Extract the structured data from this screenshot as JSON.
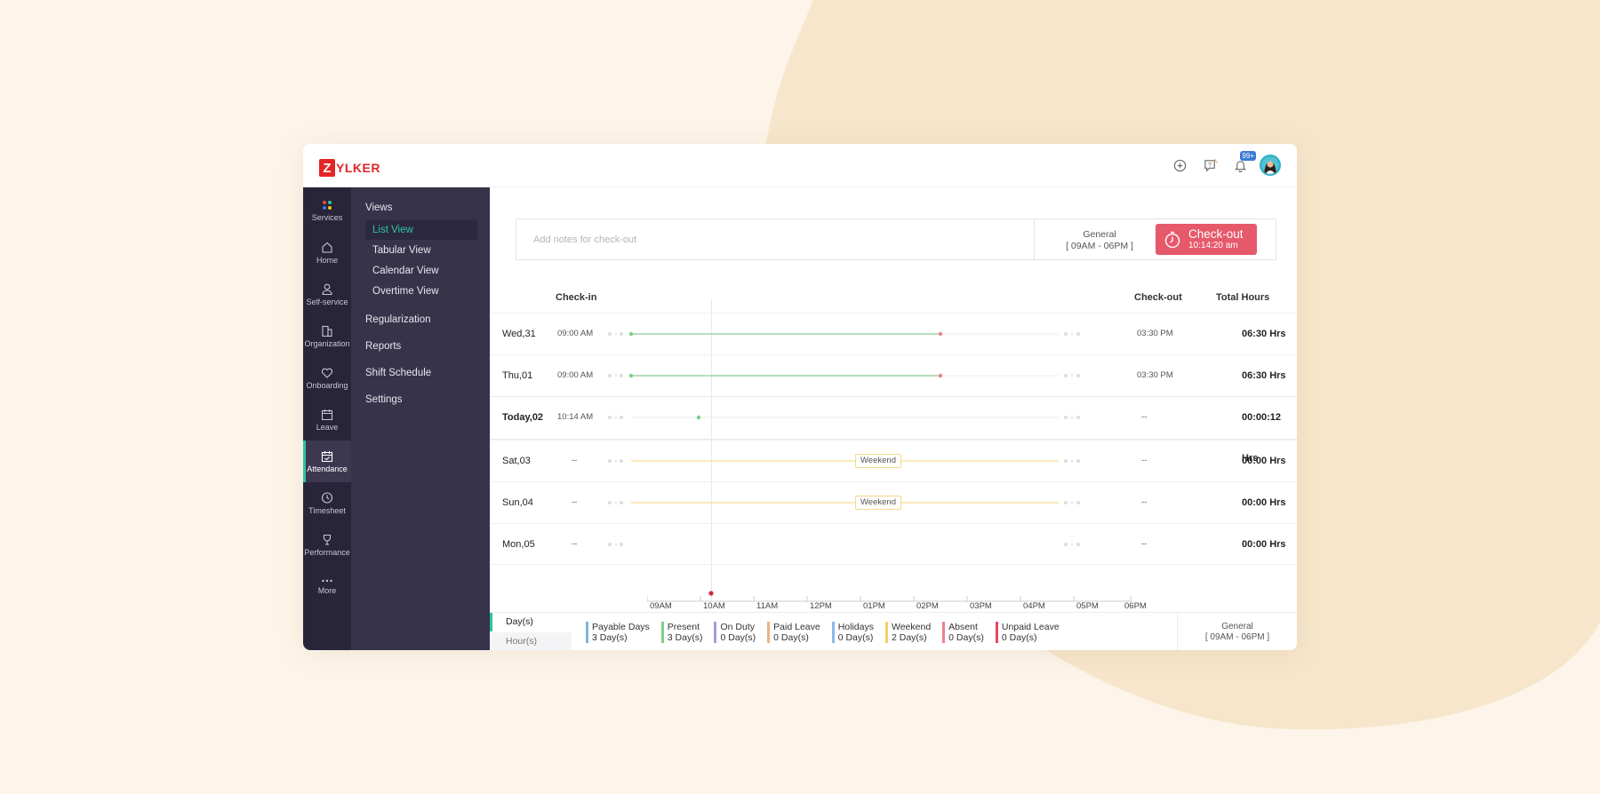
{
  "brand": {
    "logo_letter": "Z",
    "logo_rest": "YLKER",
    "color": "#e42527"
  },
  "topbar": {
    "notification_count": "99+"
  },
  "rail": [
    {
      "label": "Services",
      "icon": "services-icon"
    },
    {
      "label": "Home",
      "icon": "home-icon"
    },
    {
      "label": "Self-service",
      "icon": "user-icon"
    },
    {
      "label": "Organization",
      "icon": "building-icon"
    },
    {
      "label": "Onboarding",
      "icon": "onboarding-icon"
    },
    {
      "label": "Leave",
      "icon": "calendar-icon"
    },
    {
      "label": "Attendance",
      "icon": "attendance-icon",
      "active": true
    },
    {
      "label": "Timesheet",
      "icon": "clock-icon"
    },
    {
      "label": "Performance",
      "icon": "trophy-icon"
    },
    {
      "label": "More",
      "icon": "more-icon"
    }
  ],
  "subnav": {
    "views_heading": "Views",
    "views": [
      "List View",
      "Tabular View",
      "Calendar View",
      "Overtime View"
    ],
    "active_view": "List View",
    "sections": [
      "Regularization",
      "Reports",
      "Shift Schedule",
      "Settings"
    ]
  },
  "checkout_bar": {
    "notes_placeholder": "Add notes for check-out",
    "shift_name": "General",
    "shift_time": "[ 09AM - 06PM ]",
    "button_label": "Check-out",
    "button_time": "10:14:20 am",
    "button_color": "#e6596b"
  },
  "columns": {
    "checkin": "Check-in",
    "checkout": "Check-out",
    "total": "Total Hours"
  },
  "rows": [
    {
      "day": "Wed,31",
      "checkin": "09:00 AM",
      "checkout": "03:30 PM",
      "total": "06:30 Hrs",
      "status": "present"
    },
    {
      "day": "Thu,01",
      "checkin": "09:00 AM",
      "checkout": "03:30 PM",
      "total": "06:30 Hrs",
      "status": "present"
    },
    {
      "day": "Today,02",
      "checkin": "10:14 AM",
      "checkout": "--",
      "total": "00:00:12 Hrs",
      "status": "today"
    },
    {
      "day": "Sat,03",
      "checkin": "--",
      "checkout": "--",
      "total": "00:00 Hrs",
      "status": "weekend",
      "tag": "Weekend"
    },
    {
      "day": "Sun,04",
      "checkin": "--",
      "checkout": "--",
      "total": "00:00 Hrs",
      "status": "weekend",
      "tag": "Weekend"
    },
    {
      "day": "Mon,05",
      "checkin": "--",
      "checkout": "--",
      "total": "00:00 Hrs",
      "status": "none"
    }
  ],
  "timeline_ticks": [
    "09AM",
    "10AM",
    "11AM",
    "12PM",
    "01PM",
    "02PM",
    "03PM",
    "04PM",
    "05PM",
    "06PM"
  ],
  "units": {
    "days": "Day(s)",
    "hours": "Hour(s)"
  },
  "legend": [
    {
      "label": "Payable Days",
      "value": "3 Day(s)",
      "color": "#7ab8d6"
    },
    {
      "label": "Present",
      "value": "3 Day(s)",
      "color": "#7ccf88"
    },
    {
      "label": "On Duty",
      "value": "0 Day(s)",
      "color": "#a79be0"
    },
    {
      "label": "Paid Leave",
      "value": "0 Day(s)",
      "color": "#f0b27a"
    },
    {
      "label": "Holidays",
      "value": "0 Day(s)",
      "color": "#8eb7e8"
    },
    {
      "label": "Weekend",
      "value": "2 Day(s)",
      "color": "#f3cf6a"
    },
    {
      "label": "Absent",
      "value": "0 Day(s)",
      "color": "#ef7f8e"
    },
    {
      "label": "Unpaid Leave",
      "value": "0 Day(s)",
      "color": "#e8485e"
    }
  ],
  "bottom_shift": {
    "name": "General",
    "time": "[ 09AM - 06PM ]"
  }
}
